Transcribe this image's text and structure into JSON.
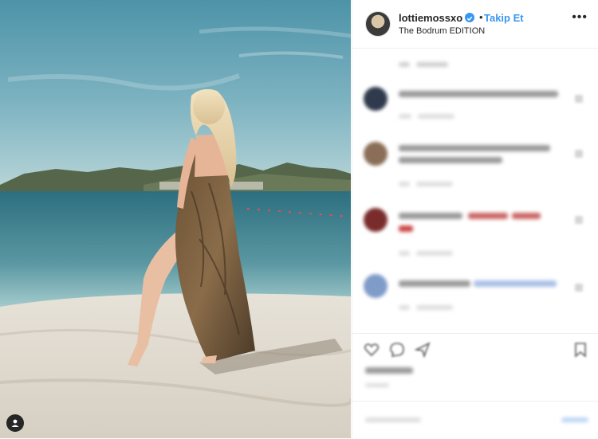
{
  "header": {
    "username": "lottiemossxo",
    "follow_label": "Takip Et",
    "separator": "•",
    "location": "The Bodrum EDITION",
    "more_label": "•••"
  },
  "icons": {
    "verified": "verified-badge-icon",
    "user_tag": "person-icon",
    "more": "more-options-icon",
    "like": "heart-icon",
    "comment": "comment-icon",
    "share": "share-icon",
    "save": "bookmark-icon"
  },
  "colors": {
    "accent": "#3897f0",
    "text": "#262626",
    "border": "#efefef"
  }
}
